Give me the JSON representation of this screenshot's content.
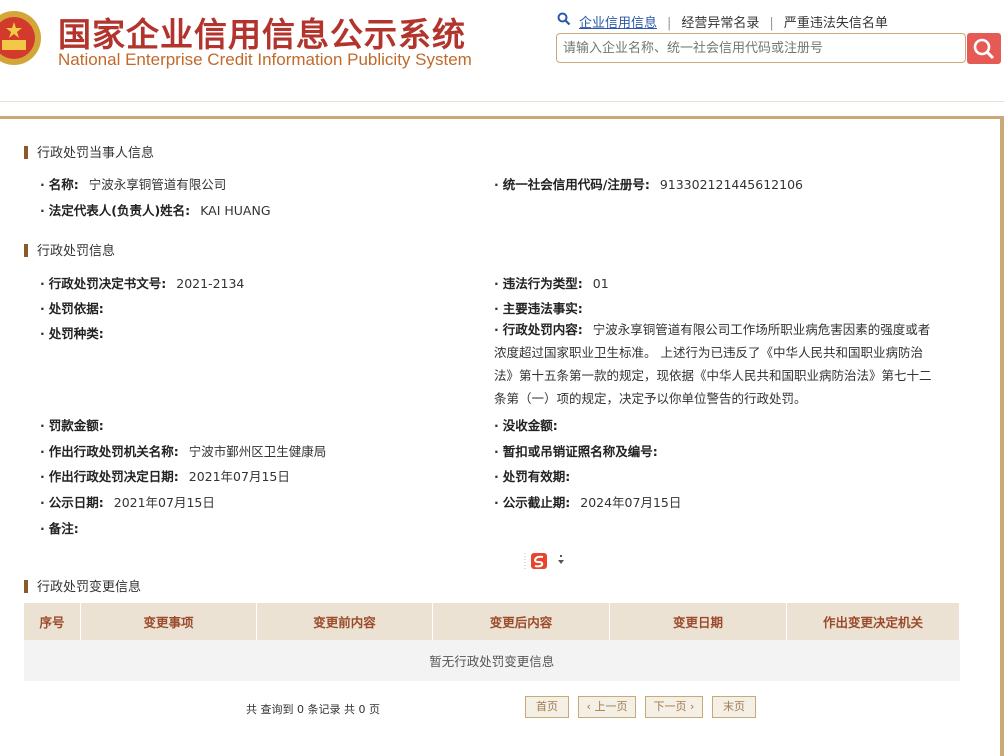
{
  "header": {
    "title_cn": "国家企业信用信息公示系统",
    "title_en": "National Enterprise Credit Information Publicity System",
    "nav": [
      "企业信用信息",
      "经营异常名录",
      "严重违法失信名单"
    ],
    "search_placeholder": "请输入企业名称、统一社会信用代码或注册号"
  },
  "party": {
    "section_title": "行政处罚当事人信息",
    "name_label": "名称:",
    "name_value": "宁波永享铜管道有限公司",
    "credit_label": "统一社会信用代码/注册号:",
    "credit_value": "913302121445612106",
    "legal_label": "法定代表人(负责人)姓名:",
    "legal_value": "KAI HUANG"
  },
  "penalty": {
    "section_title": "行政处罚信息",
    "doc_no_label": "行政处罚决定书文号:",
    "doc_no_value": "2021-2134",
    "violation_type_label": "违法行为类型:",
    "violation_type_value": "01",
    "basis_label": "处罚依据:",
    "basis_value": "",
    "facts_label": "主要违法事实:",
    "facts_value": "",
    "kind_label": "处罚种类:",
    "kind_value": "",
    "content_label": "行政处罚内容:",
    "content_value": "宁波永享铜管道有限公司工作场所职业病危害因素的强度或者浓度超过国家职业卫生标准。 上述行为已违反了《中华人民共和国职业病防治法》第十五条第一款的规定，现依据《中华人民共和国职业病防治法》第七十二条第（一）项的规定，决定予以你单位警告的行政处罚。",
    "fine_label": "罚款金额:",
    "fine_value": "",
    "confiscation_label": "没收金额:",
    "confiscation_value": "",
    "authority_label": "作出行政处罚机关名称:",
    "authority_value": "宁波市鄞州区卫生健康局",
    "license_label": "暂扣或吊销证照名称及编号:",
    "license_value": "",
    "decision_date_label": "作出行政处罚决定日期:",
    "decision_date_value": "2021年07月15日",
    "validity_label": "处罚有效期:",
    "validity_value": "",
    "publish_date_label": "公示日期:",
    "publish_date_value": "2021年07月15日",
    "publish_end_label": "公示截止期:",
    "publish_end_value": "2024年07月15日",
    "remark_label": "备注:",
    "remark_value": ""
  },
  "changes": {
    "section_title": "行政处罚变更信息",
    "columns": [
      "序号",
      "变更事项",
      "变更前内容",
      "变更后内容",
      "变更日期",
      "作出变更决定机关"
    ],
    "empty_text": "暂无行政处罚变更信息"
  },
  "pager": {
    "info": "共 查询到 0 条记录 共 0 页",
    "first": "首页",
    "prev": "上一页",
    "next": "下一页",
    "last": "末页"
  },
  "colors": {
    "accent_brown": "#c9a977",
    "title_red": "#b2342c",
    "search_button": "#e55a54",
    "table_header_bg": "#ece2d3"
  },
  "icons": [
    "national-emblem-icon",
    "search-icon",
    "sogou-input-icon"
  ]
}
